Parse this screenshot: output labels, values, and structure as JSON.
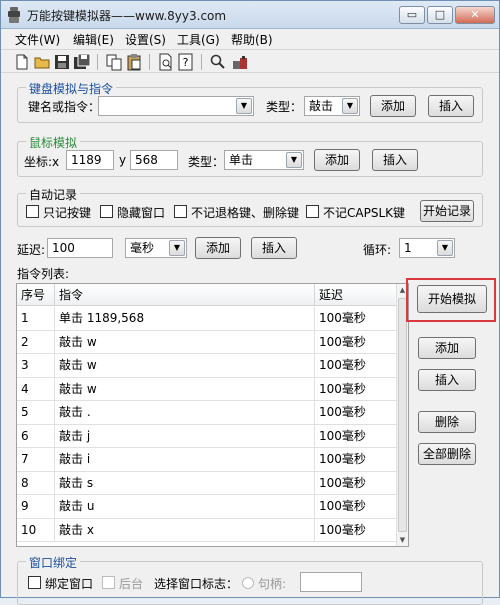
{
  "window": {
    "title": "万能按键模拟器——www.8yy3.com",
    "minimize_glyph": "▭",
    "maximize_glyph": "□",
    "close_glyph": "✕"
  },
  "menu": [
    "文件(W)",
    "编辑(E)",
    "设置(S)",
    "工具(G)",
    "帮助(B)"
  ],
  "toolbar_icons": [
    "new-file-icon",
    "open-folder-icon",
    "save-icon",
    "save-as-icon",
    "copy-icon",
    "paste-icon",
    "print-preview-icon",
    "help-icon",
    "search-icon",
    "record-icon"
  ],
  "keyboard": {
    "title": "键盘模拟与指令",
    "key_label": "键名或指令：",
    "key_value": "",
    "type_label": "类型：",
    "type_value": "敲击",
    "add": "添加",
    "insert": "插入"
  },
  "mouse": {
    "title": "鼠标模拟",
    "coord_label": "坐标:x",
    "x_value": "1189",
    "y_label": "y",
    "y_value": "568",
    "type_label": "类型：",
    "type_value": "单击",
    "add": "添加",
    "insert": "插入"
  },
  "autorecord": {
    "title": "自动记录",
    "opt1": "只记按键",
    "opt2": "隐藏窗口",
    "opt3": "不记退格键、删除键",
    "opt4": "不记CAPSLK键",
    "start": "开始记录"
  },
  "delay": {
    "label": "延迟:",
    "value": "100",
    "unit": "毫秒",
    "add": "添加",
    "insert": "插入",
    "loop_label": "循环:",
    "loop_value": "1"
  },
  "list": {
    "title": "指令列表:",
    "columns": [
      "序号",
      "指令",
      "延迟"
    ],
    "rows": [
      [
        "1",
        "单击 1189,568",
        "100毫秒"
      ],
      [
        "2",
        "敲击 w",
        "100毫秒"
      ],
      [
        "3",
        "敲击 w",
        "100毫秒"
      ],
      [
        "4",
        "敲击 w",
        "100毫秒"
      ],
      [
        "5",
        "敲击 .",
        "100毫秒"
      ],
      [
        "6",
        "敲击 j",
        "100毫秒"
      ],
      [
        "7",
        "敲击 i",
        "100毫秒"
      ],
      [
        "8",
        "敲击 s",
        "100毫秒"
      ],
      [
        "9",
        "敲击 u",
        "100毫秒"
      ],
      [
        "10",
        "敲击 x",
        "100毫秒"
      ]
    ]
  },
  "side_buttons": {
    "start_sim": "开始模拟",
    "add": "添加",
    "insert": "插入",
    "delete": "删除",
    "delete_all": "全部删除"
  },
  "bind": {
    "title": "窗口绑定",
    "bind_window": "绑定窗口",
    "background": "后台",
    "select_label": "选择窗口标志：",
    "handle_label": "句柄:",
    "handle_value": ""
  },
  "colors": {
    "highlight": "#d9383d",
    "group_title_blue": "#1a4fa0",
    "group_title_green": "#2a8a3a"
  }
}
